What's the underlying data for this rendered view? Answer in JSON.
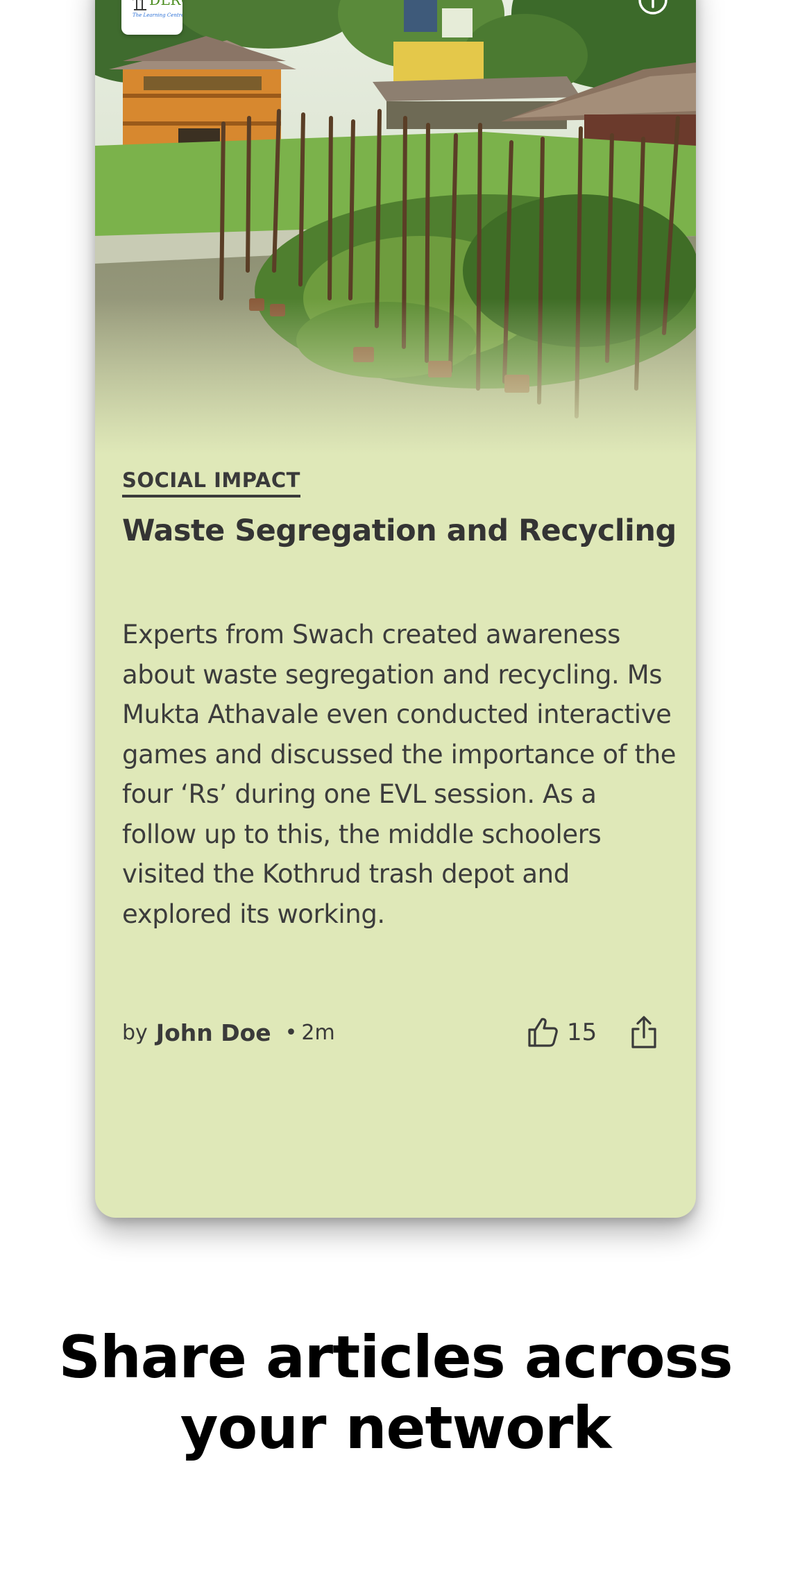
{
  "card": {
    "logo_text": "DLRC",
    "logo_tagline": "The Learning Centre",
    "category": "SOCIAL IMPACT",
    "title": "Waste Segregation and Recycling",
    "body": "Experts from Swach created awareness about waste segregation and recycling. Ms Mukta Athavale even conducted interactive games and discussed the importance of the four ‘Rs’ during one EVL session. As a follow up to this, the middle schoolers visited the Kothrud trash depot and explored its working.",
    "by_label": "by",
    "author": "John Doe",
    "separator": "•",
    "time_ago": "2m",
    "like_count": "15",
    "background_color": "#dfe8b8"
  },
  "icons": {
    "info": "info-circle-icon",
    "like": "thumbs-up-icon",
    "share": "share-icon"
  },
  "tagline": {
    "line1": "Share articles across",
    "line2": "your network"
  }
}
